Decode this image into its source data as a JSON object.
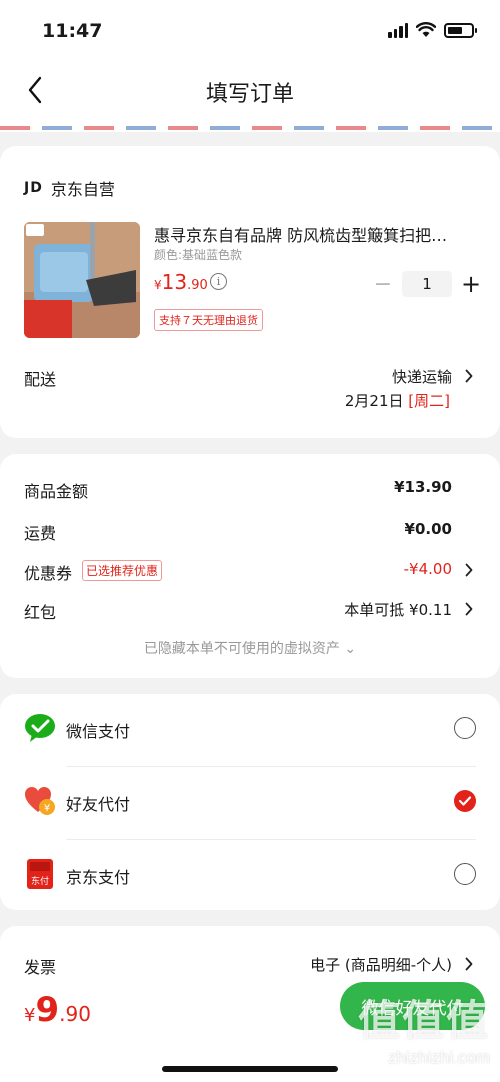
{
  "status_bar": {
    "time": "11:47"
  },
  "nav": {
    "title": "填写订单"
  },
  "shop": {
    "logo": "JD",
    "name": "京东自营"
  },
  "product": {
    "title": "惠寻京东自有品牌 防风梳齿型簸箕扫把…",
    "spec": "颜色:基础蓝色款",
    "price_symbol": "¥",
    "price_int": "13",
    "price_dec": ".90",
    "return_tag": "支持７天无理由退货",
    "quantity": "1"
  },
  "delivery": {
    "label": "配送",
    "method": "快递运输",
    "date": "2月21日",
    "weekday": "[周二]"
  },
  "summary": {
    "goods_label": "商品金额",
    "goods_value": "¥13.90",
    "shipping_label": "运费",
    "shipping_value": "¥0.00",
    "coupon_label": "优惠券",
    "coupon_tag": "已选推荐优惠",
    "coupon_value": "-¥4.00",
    "redpacket_label": "红包",
    "redpacket_value": "本单可抵 ¥0.11",
    "hidden_note": "已隐藏本单不可使用的虚拟资产 ⌄"
  },
  "payment": {
    "methods": [
      {
        "label": "微信支付",
        "icon": "wechat-pay-icon",
        "selected": false
      },
      {
        "label": "好友代付",
        "icon": "friend-pay-heart-icon",
        "selected": true
      },
      {
        "label": "京东支付",
        "icon": "jd-pay-icon",
        "selected": false
      }
    ],
    "jd_icon_text": "东付"
  },
  "invoice": {
    "label": "发票",
    "value": "电子 (商品明细-个人)"
  },
  "bottom": {
    "total_symbol": "¥",
    "total_int": "9",
    "total_dec": ".90",
    "pay_button": "微信好友代付"
  },
  "watermark": {
    "big": "值值值",
    "small": "zhizhizhi.com"
  },
  "colors": {
    "accent_red": "#e2231a",
    "wechat_green": "#32b54a"
  }
}
